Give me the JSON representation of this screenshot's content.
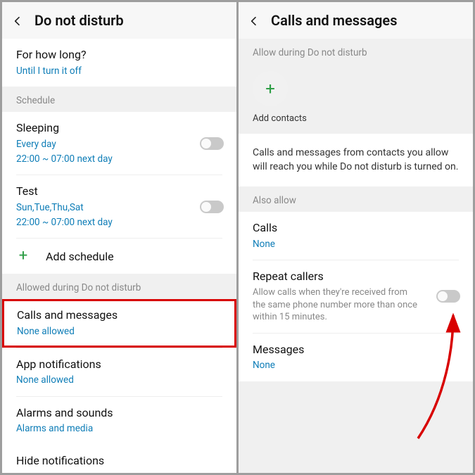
{
  "left": {
    "title": "Do not disturb",
    "for_how_long": {
      "title": "For how long?",
      "sub": "Until I turn it off"
    },
    "schedule_label": "Schedule",
    "sleeping": {
      "title": "Sleeping",
      "sub1": "Every day",
      "sub2": "22:00 ~ 07:00 next day"
    },
    "test": {
      "title": "Test",
      "sub1": "Sun,Tue,Thu,Sat",
      "sub2": "22:00 ~ 07:00 next day"
    },
    "add_schedule": "Add schedule",
    "allowed_label": "Allowed during Do not disturb",
    "calls_msgs": {
      "title": "Calls and messages",
      "sub": "None allowed"
    },
    "app_notif": {
      "title": "App notifications",
      "sub": "None allowed"
    },
    "alarms": {
      "title": "Alarms and sounds",
      "sub": "Alarms and media"
    },
    "hide_notif": "Hide notifications"
  },
  "right": {
    "title": "Calls and messages",
    "allow_label": "Allow during Do not disturb",
    "add_contacts": "Add contacts",
    "info": "Calls and messages from contacts you allow will reach you while Do not disturb is turned on.",
    "also_allow": "Also allow",
    "calls": {
      "title": "Calls",
      "sub": "None"
    },
    "repeat": {
      "title": "Repeat callers",
      "sub": "Allow calls when they're received from the same phone number more than once within 15 minutes."
    },
    "messages": {
      "title": "Messages",
      "sub": "None"
    }
  }
}
